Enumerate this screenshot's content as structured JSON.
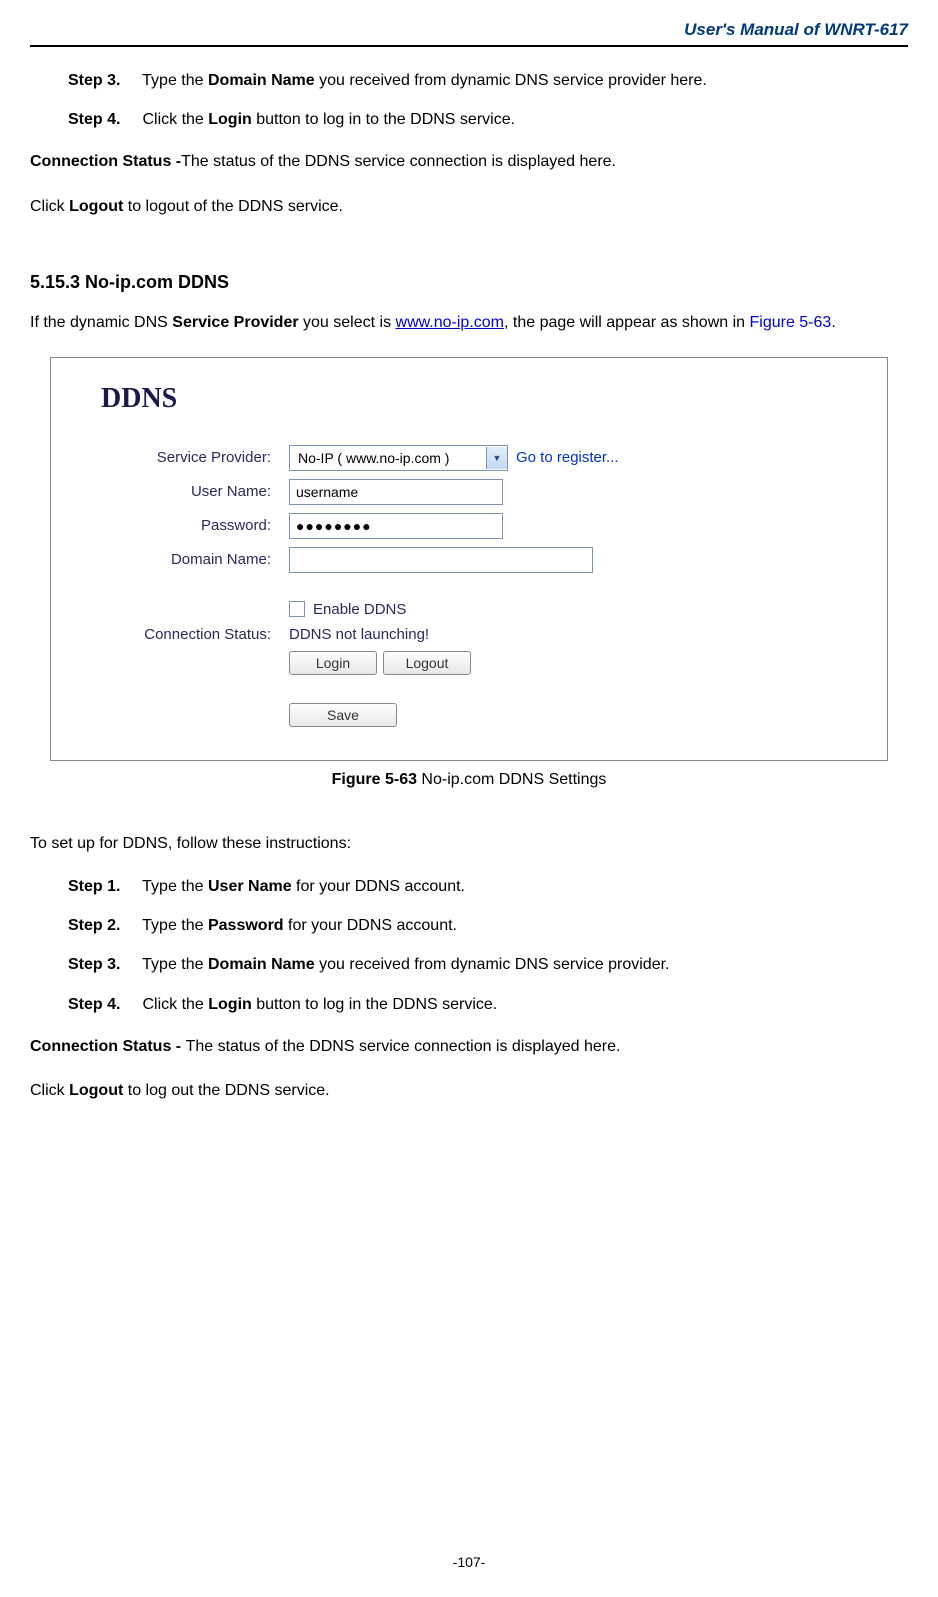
{
  "header": {
    "title": "User's Manual of WNRT-617"
  },
  "intro_steps": {
    "step3": {
      "label": "Step 3.",
      "prefix": "Type the ",
      "bold": "Domain Name",
      "suffix": " you received from dynamic DNS service provider here."
    },
    "step4": {
      "label": "Step 4.",
      "prefix": "Click the ",
      "bold": "Login",
      "suffix": " button to log in to the DDNS service."
    }
  },
  "conn_status_top": {
    "bold": "Connection Status -",
    "text": "The status of the DDNS service connection is displayed here."
  },
  "logout_top": {
    "prefix": "Click ",
    "bold": "Logout",
    "suffix": " to logout of the DDNS service."
  },
  "section": {
    "heading": "5.15.3 No-ip.com DDNS"
  },
  "intro_para": {
    "prefix": "If the dynamic DNS ",
    "bold": "Service Provider",
    "mid": " you select is ",
    "link": "www.no-ip.com",
    "suffix1": ", the page will appear as shown in ",
    "figref": "Figure 5-63",
    "suffix2": "."
  },
  "figure": {
    "title": "DDNS",
    "labels": {
      "service_provider": "Service Provider:",
      "user_name": "User Name:",
      "password": "Password:",
      "domain_name": "Domain Name:",
      "conn_status": "Connection Status:"
    },
    "values": {
      "provider_option": "No-IP ( www.no-ip.com )",
      "go_register": "Go to register...",
      "username": "username",
      "password": "●●●●●●●●",
      "domain": "",
      "enable_label": "Enable DDNS",
      "status_text": "DDNS not launching!",
      "login_btn": "Login",
      "logout_btn": "Logout",
      "save_btn": "Save"
    },
    "caption_bold": "Figure 5-63",
    "caption_rest": " No-ip.com DDNS Settings"
  },
  "setup_intro": "To set up for DDNS, follow these instructions:",
  "setup_steps": {
    "step1": {
      "label": "Step 1.",
      "prefix": "Type the ",
      "bold": "User Name",
      "suffix": " for your DDNS account."
    },
    "step2": {
      "label": "Step 2.",
      "prefix": "Type the ",
      "bold": "Password",
      "suffix": " for your DDNS account."
    },
    "step3": {
      "label": "Step 3.",
      "prefix": "Type the ",
      "bold": "Domain Name",
      "suffix": " you received from dynamic DNS service provider."
    },
    "step4": {
      "label": "Step 4.",
      "prefix": "Click the ",
      "bold": "Login",
      "suffix": " button to log in the DDNS service."
    }
  },
  "conn_status_bottom": {
    "bold": "Connection Status - ",
    "text": "The status of the DDNS service connection is displayed here."
  },
  "logout_bottom": {
    "prefix": "Click ",
    "bold": "Logout",
    "suffix": " to log out the DDNS service."
  },
  "page_number": "-107-"
}
